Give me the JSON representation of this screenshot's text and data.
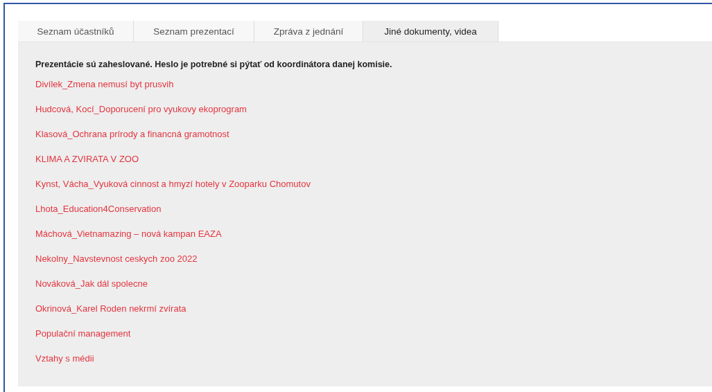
{
  "tabs": [
    {
      "label": "Seznam účastníků",
      "selected": false
    },
    {
      "label": "Seznam prezentací",
      "selected": false
    },
    {
      "label": "Zpráva z jednání",
      "selected": false
    },
    {
      "label": "Jiné dokumenty, videa",
      "selected": true
    }
  ],
  "notice": "Prezentácie sú zaheslované. Heslo je potrebné si pýtať od koordinátora danej komisie.",
  "documents": [
    "Divílek_Zmena nemusí byt prusvih",
    "Hudcová, Kocí_Doporucení pro vyukovy ekoprogram",
    "Klasová_Ochrana prírody a financná gramotnost",
    "KLIMA A ZVIRATA V ZOO",
    "Kynst, Vácha_Vyuková cinnost a hmyzí hotely v Zooparku Chomutov",
    "Lhota_Education4Conservation",
    "Máchová_Vietnamazing – nová kampan EAZA",
    "Nekolny_Navstevnost ceskych zoo 2022",
    "Nováková_Jak dál spolecne",
    "Okrinová_Karel Roden nekrmí zvírata",
    "Populační management",
    "Vztahy s médii"
  ]
}
